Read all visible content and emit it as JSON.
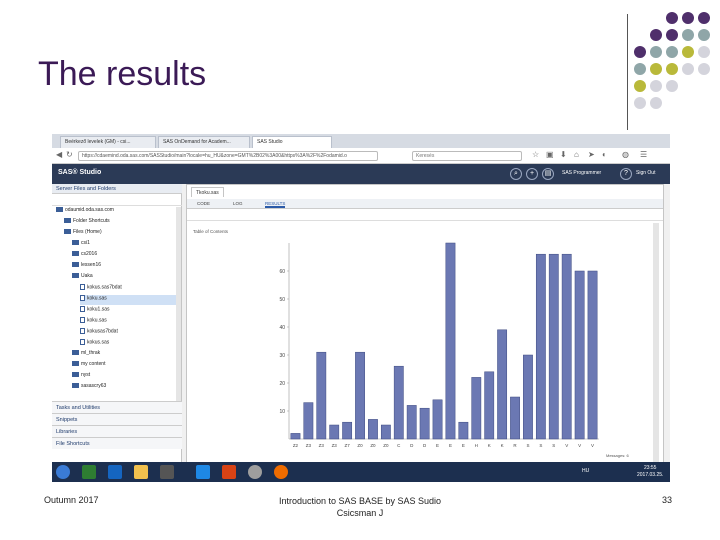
{
  "slide": {
    "title": "The results",
    "footer_left": "Outumn 2017",
    "footer_center_line1": "Introduction to SAS BASE by SAS Sudio",
    "footer_center_line2": "Csicsman J",
    "footer_right": "33"
  },
  "colors": {
    "title": "#3b1a56",
    "dot_purple": "#4f2f6b",
    "dot_teal": "#8fa6a8",
    "dot_olive": "#b9b93a",
    "dot_gray": "#d4d4dc",
    "sas_bar": "#2b3a56",
    "bar_fill": "#6b78b3"
  },
  "browser": {
    "tabs": [
      "Beérkező levelek (GM) - csi...",
      "SAS OnDemand for Academ...",
      "SAS Studio"
    ],
    "url": "https://cdaemind.oda.sas.com/SASStudio/main?locale=hu_HU&zone=GMT%2B02%3A00&https%3A%2F%2Fodamid.o",
    "search_placeholder": "Keresés"
  },
  "sas": {
    "logo": "SAS® Studio",
    "programmer": "SAS Programmer",
    "signout": "Sign Out"
  },
  "left_panel": {
    "header": "Server Files and Folders",
    "tree": [
      {
        "label": "odaumid.oda.sas.com",
        "indent": 0,
        "type": "server"
      },
      {
        "label": "Folder Shortcuts",
        "indent": 1,
        "type": "folder"
      },
      {
        "label": "Files (Home)",
        "indent": 1,
        "type": "folder"
      },
      {
        "label": "csi1",
        "indent": 2,
        "type": "folder"
      },
      {
        "label": "cs2016",
        "indent": 2,
        "type": "folder"
      },
      {
        "label": "lessen16",
        "indent": 2,
        "type": "folder"
      },
      {
        "label": "Uaka",
        "indent": 2,
        "type": "folder"
      },
      {
        "label": "kokus.sas7bdat",
        "indent": 3,
        "type": "file"
      },
      {
        "label": "koku.sas",
        "indent": 3,
        "type": "file",
        "selected": true
      },
      {
        "label": "koku1.sas",
        "indent": 3,
        "type": "file"
      },
      {
        "label": "koku.sas",
        "indent": 3,
        "type": "file"
      },
      {
        "label": "kokusas7bdat",
        "indent": 3,
        "type": "file"
      },
      {
        "label": "kokus.sas",
        "indent": 3,
        "type": "file"
      },
      {
        "label": "ml_thrak",
        "indent": 2,
        "type": "folder"
      },
      {
        "label": "my content",
        "indent": 2,
        "type": "folder"
      },
      {
        "label": "nyst",
        "indent": 2,
        "type": "folder"
      },
      {
        "label": "sasascry63",
        "indent": 2,
        "type": "folder"
      }
    ],
    "sections": [
      "Tasks and Utilities",
      "Snippets",
      "Libraries",
      "File Shortcuts"
    ]
  },
  "editor": {
    "tab": "Tkoku.sas",
    "subtabs": [
      "CODE",
      "LOG",
      "RESULTS"
    ],
    "toc": "Table of Contents",
    "messages": "Messages: 6",
    "user": "Uson: csicsmanjanos"
  },
  "taskbar": {
    "lang": "HU",
    "time": "23:55",
    "date": "2017.03.25."
  },
  "chart_data": {
    "type": "bar",
    "categories": [
      "Z2",
      "Z3",
      "Z3",
      "Z3",
      "Z7",
      "Z0",
      "Z0",
      "Z0",
      "C",
      "D",
      "D",
      "E",
      "E",
      "E",
      "H",
      "K",
      "K",
      "R",
      "S",
      "S",
      "S",
      "V",
      "V",
      "V"
    ],
    "values": [
      2,
      13,
      31,
      5,
      6,
      31,
      7,
      5,
      26,
      12,
      11,
      14,
      70,
      6,
      22,
      24,
      39,
      15,
      30,
      66,
      66,
      66,
      60,
      60
    ],
    "yticks": [
      10,
      20,
      30,
      40,
      50,
      60
    ],
    "ylim": [
      0,
      70
    ]
  }
}
